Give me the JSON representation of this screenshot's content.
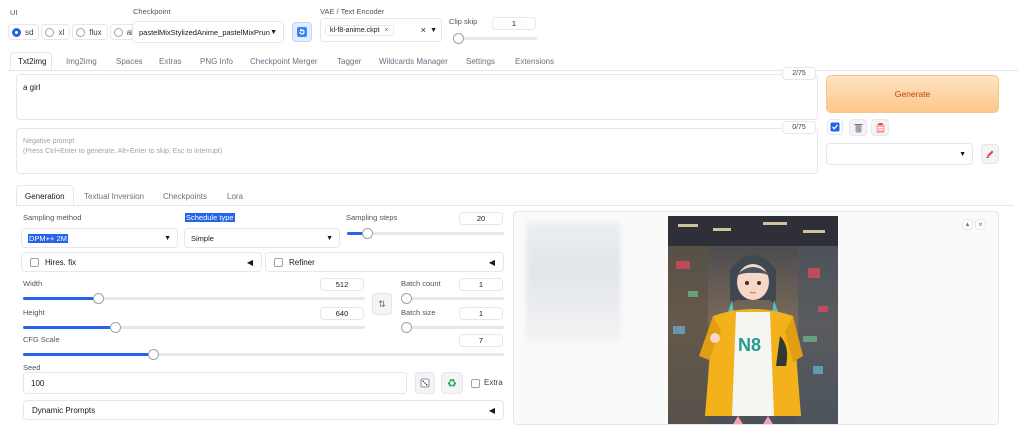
{
  "top": {
    "ui_label": "UI",
    "ui_options": [
      {
        "label": "sd",
        "selected": true
      },
      {
        "label": "xl",
        "selected": false
      },
      {
        "label": "flux",
        "selected": false
      },
      {
        "label": "all",
        "selected": false
      }
    ],
    "checkpoint_label": "Checkpoint",
    "checkpoint_value": "pastelMixStylizedAnime_pastelMixPrunedFP16",
    "vae_label": "VAE / Text Encoder",
    "vae_chip": "kl-f8-anime.ckpt",
    "vae_chip_remove": "×",
    "vae_clear": "×",
    "clip_skip_label": "Clip skip",
    "clip_skip_value": "1"
  },
  "tabs": [
    "Txt2img",
    "Img2img",
    "Spaces",
    "Extras",
    "PNG Info",
    "Checkpoint Merger",
    "Tagger",
    "Wildcards Manager",
    "Settings",
    "Extensions"
  ],
  "prompt": {
    "value": "a girl",
    "token_count": "2/75",
    "negative_placeholder": "Negative prompt\n(Press Ctrl+Enter to generate, Alt+Enter to skip, Esc to interrupt)",
    "negative_token_count": "0/75"
  },
  "generate_label": "Generate",
  "subtabs": [
    "Generation",
    "Textual Inversion",
    "Checkpoints",
    "Lora"
  ],
  "params": {
    "sampling_method_label": "Sampling method",
    "sampling_method_value": "DPM++ 2M",
    "schedule_type_label": "Schedule type",
    "schedule_type_value": "Simple",
    "sampling_steps_label": "Sampling steps",
    "sampling_steps_value": "20",
    "hires_fix_label": "Hires. fix",
    "refiner_label": "Refiner",
    "width_label": "Width",
    "width_value": "512",
    "height_label": "Height",
    "height_value": "640",
    "batch_count_label": "Batch count",
    "batch_count_value": "1",
    "batch_size_label": "Batch size",
    "batch_size_value": "1",
    "cfg_label": "CFG Scale",
    "cfg_value": "7",
    "seed_label": "Seed",
    "seed_value": "100",
    "extra_label": "Extra",
    "dynamic_prompts_label": "Dynamic Prompts"
  },
  "slider_fractions": {
    "clip_skip": 0.0,
    "sampling_steps": 0.13,
    "width": 0.22,
    "height": 0.27,
    "batch_count": 0.0,
    "batch_size": 0.0,
    "cfg": 0.27
  },
  "image_panel": {
    "up_icon": "▲",
    "close_icon": "×"
  },
  "colors": {
    "accent": "#2563eb",
    "generate_bg_top": "#fde3c3",
    "generate_bg_bottom": "#fdc78a",
    "generate_text": "#c2410c"
  }
}
